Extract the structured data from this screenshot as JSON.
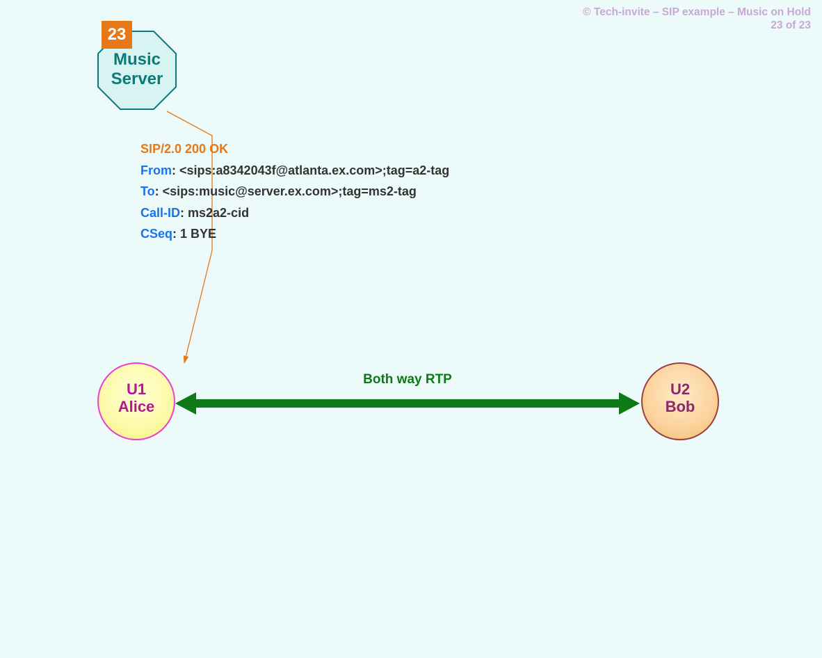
{
  "header": {
    "copyright": "© Tech-invite – SIP example – Music on Hold",
    "page": "23 of 23"
  },
  "step": {
    "number": "23"
  },
  "music_server": {
    "line1": "Music",
    "line2": "Server"
  },
  "sip": {
    "status": "SIP/2.0 200 OK",
    "from_label": "From",
    "from_value": ": <sips:a8342043f@atlanta.ex.com>;tag=a2-tag",
    "to_label": "To",
    "to_value": ": <sips:music@server.ex.com>;tag=ms2-tag",
    "callid_label": "Call-ID",
    "callid_value": ": ms2a2-cid",
    "cseq_label": "CSeq",
    "cseq_value": ": 1 BYE"
  },
  "nodes": {
    "alice": {
      "line1": "U1",
      "line2": "Alice"
    },
    "bob": {
      "line1": "U2",
      "line2": "Bob"
    }
  },
  "rtp": {
    "label": "Both way RTP"
  },
  "colors": {
    "accent_orange": "#e67817",
    "teal": "#0d7a7a",
    "blue": "#1a73e8",
    "magenta": "#e83fd3",
    "green": "#0d7a17"
  }
}
